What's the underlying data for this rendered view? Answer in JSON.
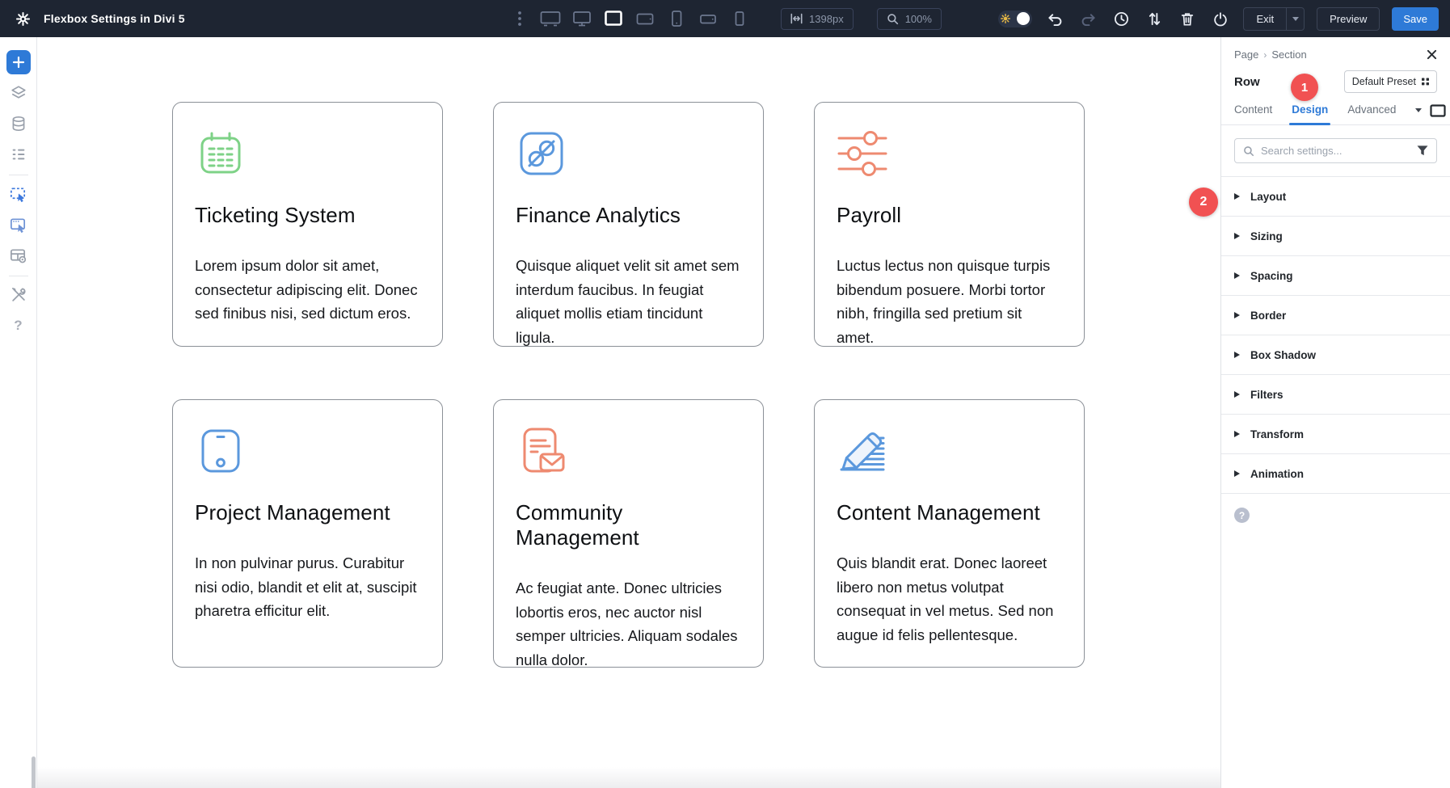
{
  "topbar": {
    "title": "Flexbox Settings in Divi 5",
    "width_value": "1398px",
    "zoom_value": "100%",
    "buttons": {
      "exit": "Exit",
      "preview": "Preview",
      "save": "Save"
    },
    "icons": [
      "gear-icon",
      "more-dots-icon",
      "desktop-xl-icon",
      "desktop-icon",
      "laptop-icon",
      "tablet-landscape-icon",
      "phone-portrait-icon",
      "phone-landscape-icon",
      "phone-small-icon",
      "width-arrows-icon",
      "zoom-magnifier-icon",
      "light-mode-toggle",
      "undo-icon",
      "redo-icon",
      "history-icon",
      "sort-arrows-icon",
      "trash-icon",
      "power-icon"
    ]
  },
  "sidebar": {
    "icons": [
      "add-button",
      "layers-icon",
      "database-icon",
      "list-rows-icon",
      "insert-module-icon",
      "insert-module-alt-icon",
      "table-settings-icon",
      "tools-icon",
      "help-icon"
    ],
    "help_glyph": "?"
  },
  "canvas": {
    "cards": [
      {
        "icon": "calendar-icon",
        "icon_color": "green",
        "title": "Ticketing System",
        "body": "Lorem ipsum dolor sit amet, consectetur adipiscing elit. Donec sed finibus nisi, sed dictum eros."
      },
      {
        "icon": "linked-nodes-icon",
        "icon_color": "blue",
        "title": "Finance Analytics",
        "body": "Quisque aliquet velit sit amet sem interdum faucibus. In feugiat aliquet mollis etiam tincidunt ligula."
      },
      {
        "icon": "sliders-icon",
        "icon_color": "coral",
        "title": "Payroll",
        "body": "Luctus lectus non quisque turpis bibendum posuere. Morbi tortor nibh, fringilla sed pretium sit amet."
      },
      {
        "icon": "tablet-device-icon",
        "icon_color": "blue",
        "title": "Project Management",
        "body": "In non pulvinar purus. Curabitur nisi odio, blandit et elit at, suscipit pharetra efficitur elit."
      },
      {
        "icon": "document-mail-icon",
        "icon_color": "coral",
        "title": "Community Management",
        "body": "Ac feugiat ante. Donec ultricies lobortis eros, nec auctor nisl semper ultricies. Aliquam sodales nulla dolor."
      },
      {
        "icon": "pencil-lines-icon",
        "icon_color": "blue",
        "title": "Content Management",
        "body": "Quis blandit erat. Donec laoreet libero non metus volutpat consequat in vel metus. Sed non augue id felis pellentesque."
      }
    ]
  },
  "panel": {
    "breadcrumb": [
      "Page",
      "Section"
    ],
    "element_label": "Row",
    "step_badges": [
      "1",
      "2"
    ],
    "preset_button": "Default Preset",
    "tabs": [
      "Content",
      "Design",
      "Advanced"
    ],
    "active_tab": "Design",
    "search_placeholder": "Search settings...",
    "sections": [
      "Layout",
      "Sizing",
      "Spacing",
      "Border",
      "Box Shadow",
      "Filters",
      "Transform",
      "Animation"
    ],
    "help_glyph": "?"
  },
  "colors": {
    "topbar-bg": "#1e2532",
    "accent-blue": "#2e7ad7",
    "badge-red": "#f15152",
    "icon-green": "#7ed287",
    "icon-blue": "#5b98dd",
    "icon-coral": "#ee8a70"
  }
}
